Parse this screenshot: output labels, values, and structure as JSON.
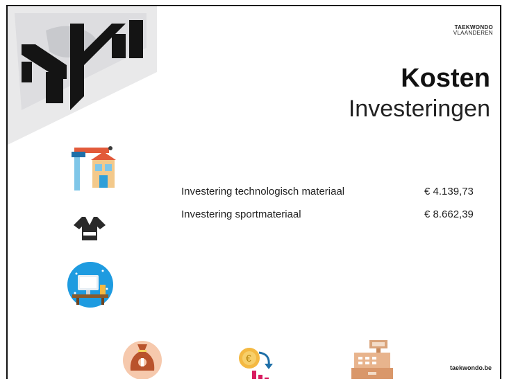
{
  "brand": {
    "line1": "TAEKWONDO",
    "line2": "VLAANDEREN"
  },
  "title": "Kosten",
  "subtitle": "Investeringen",
  "costs": [
    {
      "label": "Investering technologisch materiaal",
      "amount": "€ 4.139,73"
    },
    {
      "label": "Investering sportmateriaal",
      "amount": "€ 8.662,39"
    }
  ],
  "footer": "taekwondo.be",
  "icons": {
    "tools": "tools-house-icon",
    "dobok": "dobok-uniform-icon",
    "tech": "computer-desk-icon",
    "money_bag": "money-bag-icon",
    "coin_chart": "coin-decline-chart-icon",
    "register": "cash-register-icon"
  },
  "colors": {
    "accent_orange": "#e07a4a",
    "accent_blue": "#1e88c9",
    "accent_pink": "#d81b60"
  }
}
